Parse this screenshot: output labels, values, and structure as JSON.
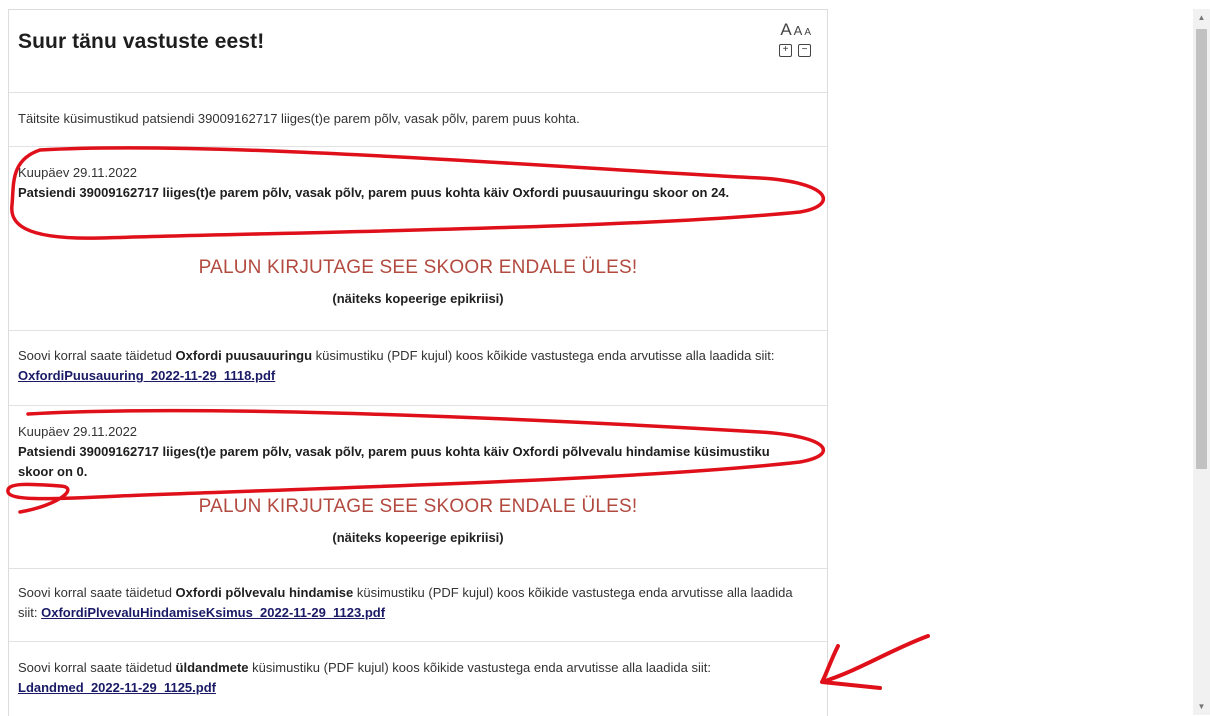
{
  "header": {
    "title": "Suur tänu vastuste eest!",
    "font_size_glyph": "A",
    "zoom_in_glyph": "+",
    "zoom_out_glyph": "−"
  },
  "intro": "Täitsite küsimustikud patsiendi 39009162717 liiges(t)e parem põlv, vasak põlv, parem puus kohta.",
  "scores": [
    {
      "date": "Kuupäev 29.11.2022",
      "text": "Patsiendi 39009162717 liiges(t)e parem põlv, vasak põlv, parem puus kohta käiv Oxfordi puusauuringu skoor on 24.",
      "notice": "PALUN KIRJUTAGE SEE SKOOR ENDALE ÜLES!",
      "hint": "(näiteks kopeerige epikriisi)"
    },
    {
      "date": "Kuupäev 29.11.2022",
      "text": "Patsiendi 39009162717 liiges(t)e parem põlv, vasak põlv, parem puus kohta käiv Oxfordi põlvevalu hindamise küsimustiku skoor on 0.",
      "notice": "PALUN KIRJUTAGE SEE SKOOR ENDALE ÜLES!",
      "hint": "(näiteks kopeerige epikriisi)"
    }
  ],
  "downloads": [
    {
      "pre": "Soovi korral saate täidetud ",
      "name": "Oxfordi puusauuringu",
      "post": " küsimustiku (PDF kujul) koos kõikide vastustega enda arvutisse alla laadida siit: ",
      "link": "OxfordiPuusauuring_2022-11-29_1118.pdf"
    },
    {
      "pre": "Soovi korral saate täidetud ",
      "name": "Oxfordi põlvevalu hindamise",
      "post": " küsimustiku (PDF kujul) koos kõikide vastustega enda arvutisse alla laadida siit: ",
      "link": "OxfordiPlvevaluHindamiseKsimus_2022-11-29_1123.pdf"
    },
    {
      "pre": "Soovi korral saate täidetud ",
      "name": "üldandmete",
      "post": " küsimustiku (PDF kujul) koos kõikide vastustega enda arvutisse alla laadida siit: ",
      "link": "Ldandmed_2022-11-29_1125.pdf"
    }
  ],
  "colors": {
    "notice": "#b24a40",
    "link": "#1a1a66",
    "annotation": "#e0101a"
  },
  "icons": {
    "scroll_up": "chevron-up-icon",
    "scroll_down": "chevron-down-icon"
  }
}
